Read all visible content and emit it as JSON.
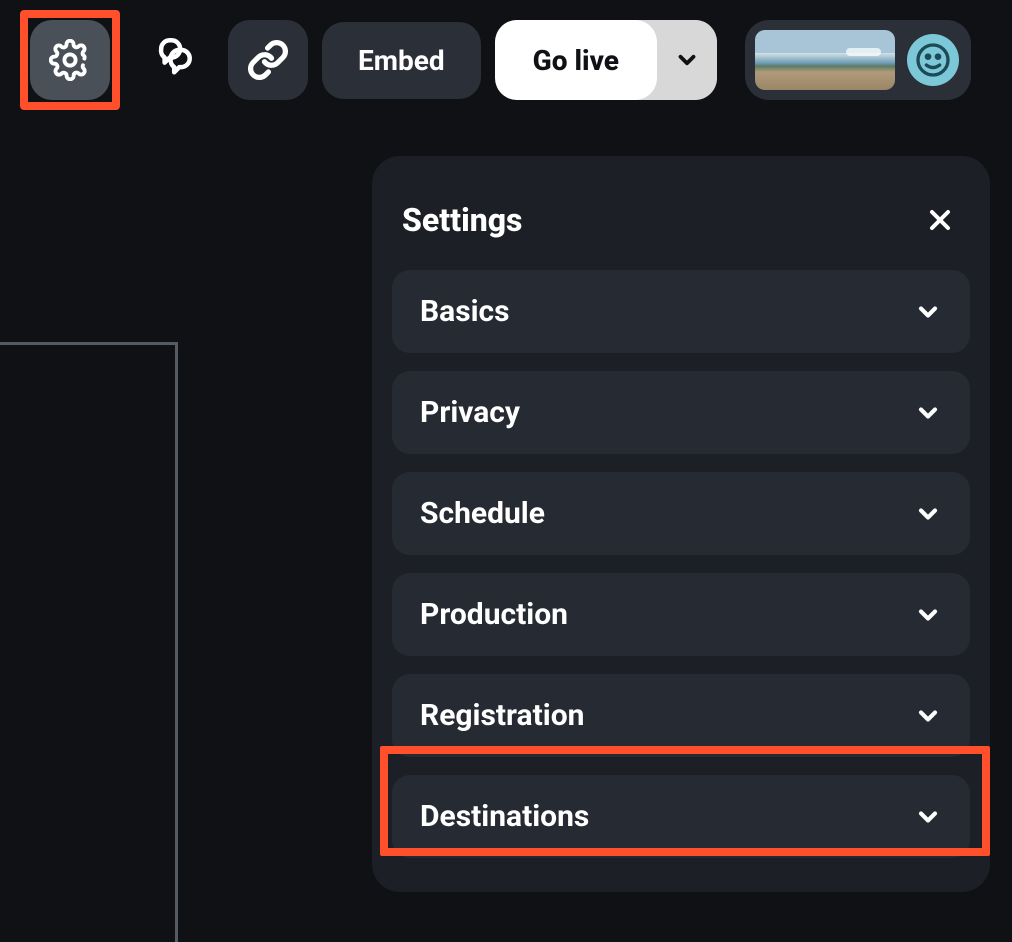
{
  "topbar": {
    "embed_label": "Embed",
    "golive_label": "Go live"
  },
  "settings": {
    "title": "Settings",
    "items": [
      {
        "label": "Basics"
      },
      {
        "label": "Privacy"
      },
      {
        "label": "Schedule"
      },
      {
        "label": "Production"
      },
      {
        "label": "Registration"
      },
      {
        "label": "Destinations"
      }
    ]
  },
  "highlights": {
    "settings_icon_highlighted": true,
    "destinations_highlighted": true
  },
  "colors": {
    "highlight": "#ff4f2b",
    "bg": "#0f1114",
    "panel": "#1c2026",
    "item": "#262b33"
  }
}
